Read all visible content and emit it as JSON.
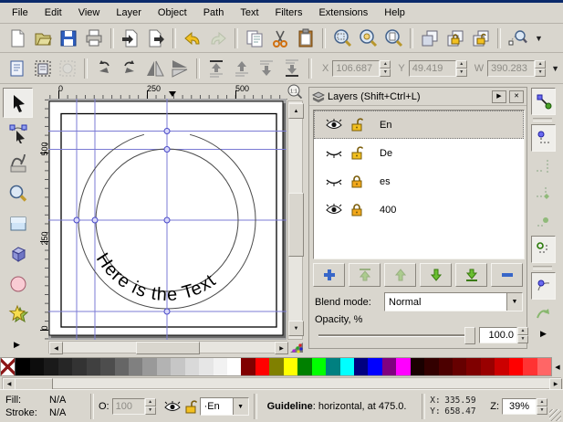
{
  "menu": {
    "items": [
      "File",
      "Edit",
      "View",
      "Layer",
      "Object",
      "Path",
      "Text",
      "Filters",
      "Extensions",
      "Help"
    ]
  },
  "toolbar_commands": {
    "icons": [
      "new-document",
      "open",
      "save",
      "print",
      "import",
      "export",
      "undo",
      "redo",
      "copy",
      "cut",
      "paste",
      "zoom-selection",
      "zoom-drawing",
      "zoom-page",
      "duplicate",
      "create-clone",
      "unlink-clone",
      "find"
    ]
  },
  "toolbar_select": {
    "icons": [
      "select-all",
      "select-all-layers",
      "deselect",
      "rotate-ccw",
      "rotate-cw",
      "flip-horizontal",
      "flip-vertical",
      "raise-to-top",
      "raise",
      "lower",
      "lower-to-bottom"
    ],
    "fields": [
      {
        "label": "X",
        "value": "106.687"
      },
      {
        "label": "Y",
        "value": "49.419"
      },
      {
        "label": "W",
        "value": "390.283"
      }
    ]
  },
  "tools": {
    "items": [
      "selector",
      "node-editor",
      "tweak",
      "zoom",
      "rectangle",
      "box-3d",
      "ellipse",
      "star"
    ],
    "active": "selector"
  },
  "canvas": {
    "ruler_h_labels": [
      "0",
      "250",
      "500"
    ],
    "ruler_v_labels": [
      "500",
      "250",
      "0"
    ],
    "text_on_path": "Here is the Text",
    "zoom_corner": "1:1"
  },
  "layers_panel": {
    "title": "Layers (Shift+Ctrl+L)",
    "rows": [
      {
        "name": "En",
        "visible": true,
        "locked": false,
        "selected": true
      },
      {
        "name": "De",
        "visible": false,
        "locked": false,
        "selected": false
      },
      {
        "name": "es",
        "visible": false,
        "locked": true,
        "selected": false
      },
      {
        "name": "400",
        "visible": true,
        "locked": true,
        "selected": false
      }
    ],
    "blend_label": "Blend mode:",
    "blend_value": "Normal",
    "opacity_label": "Opacity, %",
    "opacity_value": "100.0"
  },
  "snap_toolbar": {
    "icons": [
      "snap-toggle",
      "snap-bounding-box",
      "snap-bbox-edges",
      "snap-bbox-corners",
      "snap-nodes",
      "snap-node-cusp",
      "snap-smooth-nodes",
      "rotate-helper"
    ]
  },
  "palette": {
    "colors": [
      "none",
      "#000000",
      "#0d0d0d",
      "#1a1a1a",
      "#262626",
      "#333333",
      "#404040",
      "#4d4d4d",
      "#666666",
      "#808080",
      "#999999",
      "#b3b3b3",
      "#c6c6c6",
      "#d9d9d9",
      "#e6e6e6",
      "#f2f2f2",
      "#ffffff",
      "#800000",
      "#ff0000",
      "#808000",
      "#ffff00",
      "#008000",
      "#00ff00",
      "#008080",
      "#00ffff",
      "#000080",
      "#0000ff",
      "#800080",
      "#ff00ff",
      "#190000",
      "#330000",
      "#4c0000",
      "#660000",
      "#7f0000",
      "#990000",
      "#cc0000",
      "#ff0000",
      "#ff3333",
      "#ff6666"
    ]
  },
  "statusbar": {
    "fill_label": "Fill:",
    "fill_value": "N/A",
    "stroke_label": "Stroke:",
    "stroke_value": "N/A",
    "opacity_label": "O:",
    "opacity_value": "100",
    "layer_value": "·En",
    "message_bold": "Guideline",
    "message_rest": ": horizontal, at 475.0.",
    "x_label": "X:",
    "x_value": "335.59",
    "y_label": "Y:",
    "y_value": "658.47",
    "zoom_label": "Z:",
    "zoom_value": "39%"
  }
}
